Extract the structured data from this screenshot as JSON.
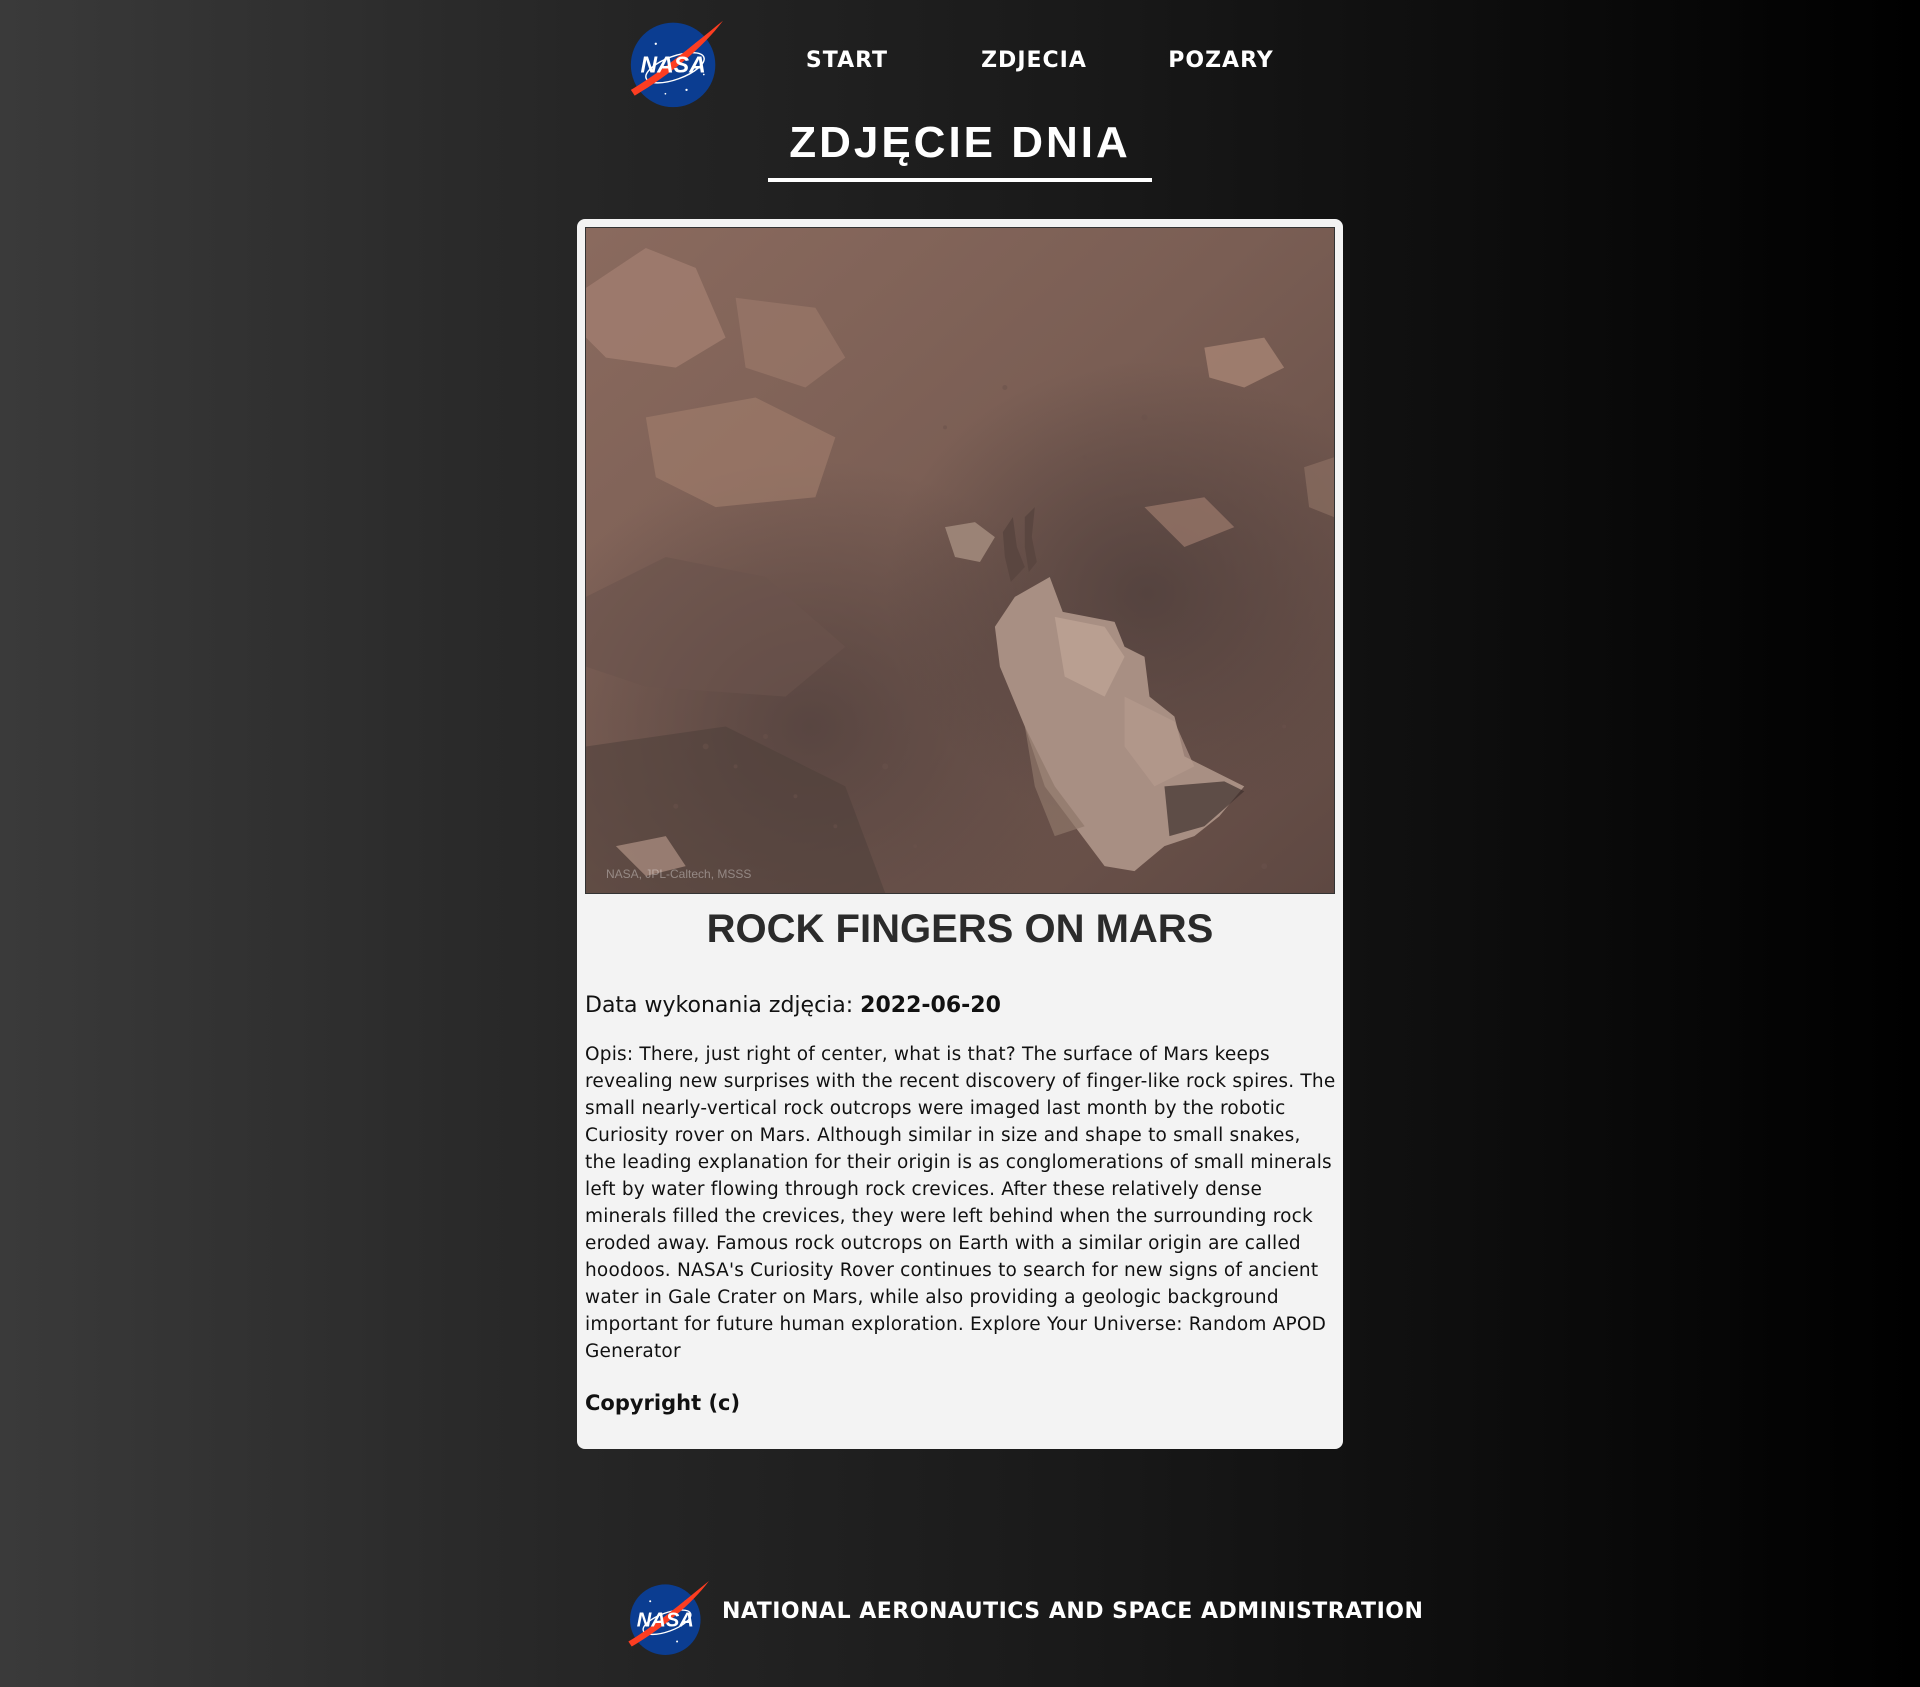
{
  "header": {
    "logo_text": "NASA",
    "nav": [
      {
        "label": "START"
      },
      {
        "label": "ZDJECIA"
      },
      {
        "label": "POZARY"
      }
    ]
  },
  "page_title": "ZDJĘCIE DNIA",
  "apod": {
    "image_credit": "NASA, JPL-Caltech, MSSS",
    "title": "ROCK FINGERS ON MARS",
    "date_label": "Data wykonania zdjęcia:",
    "date_value": "2022-06-20",
    "description": "Opis: There, just right of center, what is that? The surface of Mars keeps revealing new surprises with the recent discovery of finger-like rock spires. The small nearly-vertical rock outcrops were imaged last month by the robotic Curiosity rover on Mars. Although similar in size and shape to small snakes, the leading explanation for their origin is as conglomerations of small minerals left by water flowing through rock crevices. After these relatively dense minerals filled the crevices, they were left behind when the surrounding rock eroded away. Famous rock outcrops on Earth with a similar origin are called hoodoos. NASA's Curiosity Rover continues to search for new signs of ancient water in Gale Crater on Mars, while also providing a geologic background important for future human exploration. Explore Your Universe: Random APOD Generator",
    "copyright": "Copyright (c)"
  },
  "footer": {
    "logo_text": "NASA",
    "text": "NATIONAL AERONAUTICS AND SPACE ADMINISTRATION"
  },
  "colors": {
    "nasa_blue": "#0b3d91",
    "nasa_red": "#fc3d21",
    "card_bg": "#f3f3f3"
  }
}
